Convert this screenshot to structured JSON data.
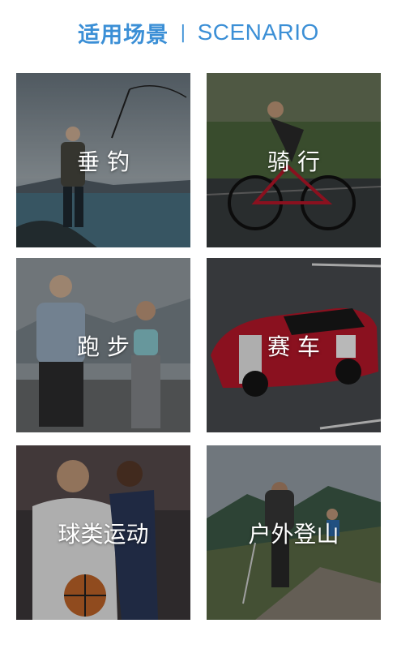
{
  "header": {
    "title_cn": "适用场景",
    "separator": "|",
    "title_en": "SCENARIO",
    "color": "#3b8fd6"
  },
  "scenarios": [
    {
      "label": "垂 钓"
    },
    {
      "label": "骑 行"
    },
    {
      "label": "跑 步"
    },
    {
      "label": "赛 车"
    },
    {
      "label": "球类运动"
    },
    {
      "label": "户外登山"
    }
  ]
}
